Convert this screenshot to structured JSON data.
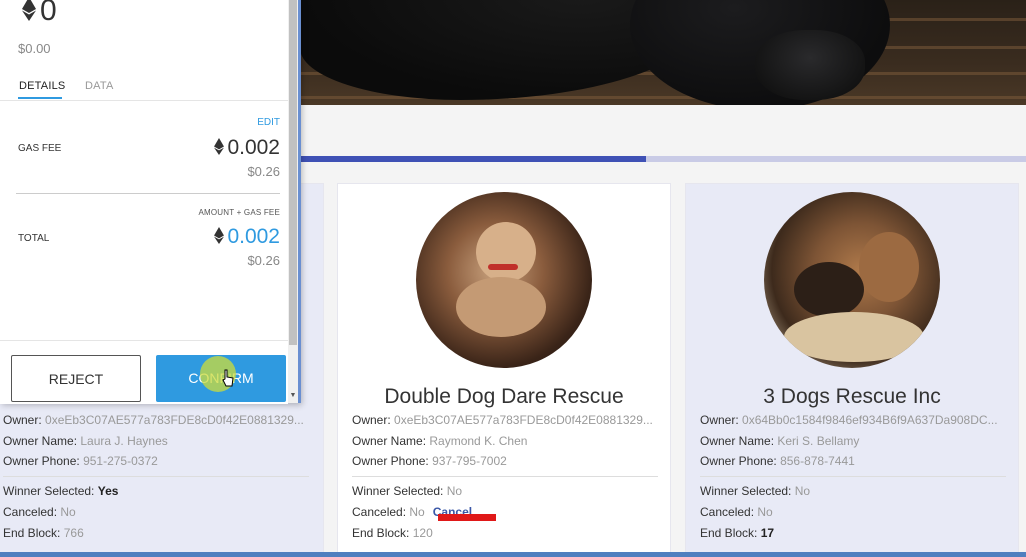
{
  "wallet": {
    "amount": "0",
    "usd": "$0.00",
    "tabs": [
      "DETAILS",
      "DATA"
    ],
    "edit_label": "EDIT",
    "gas_fee_label": "GAS FEE",
    "gas_fee_eth": "0.002",
    "gas_fee_usd": "$0.26",
    "amount_gas_label": "AMOUNT + GAS FEE",
    "total_label": "TOTAL",
    "total_eth": "0.002",
    "total_usd": "$0.26",
    "reject_label": "REJECT",
    "confirm_label": "CONFIRM",
    "accent": "#2f9ae0"
  },
  "progress_fraction": 0.477,
  "cards": {
    "left": {
      "owner_label": "Owner:",
      "owner": "0xeEb3C07AE577a783FDE8cD0f42E0881329...",
      "owner_name_label": "Owner Name:",
      "owner_name": "Laura J. Haynes",
      "owner_phone_label": "Owner Phone:",
      "owner_phone": "951-275-0372",
      "winner_label": "Winner Selected:",
      "winner": "Yes",
      "canceled_label": "Canceled:",
      "canceled": "No",
      "end_block_label": "End Block:",
      "end_block": "766"
    },
    "mid": {
      "title": "Double Dog Dare Rescue",
      "owner_label": "Owner:",
      "owner": "0xeEb3C07AE577a783FDE8cD0f42E0881329...",
      "owner_name_label": "Owner Name:",
      "owner_name": "Raymond K. Chen",
      "owner_phone_label": "Owner Phone:",
      "owner_phone": "937-795-7002",
      "winner_label": "Winner Selected:",
      "winner": "No",
      "canceled_label": "Canceled:",
      "canceled": "No",
      "cancel_link": "Cancel",
      "end_block_label": "End Block:",
      "end_block": "120"
    },
    "right": {
      "title": "3 Dogs Rescue Inc",
      "owner_label": "Owner:",
      "owner": "0x64Bb0c1584f9846ef934B6f9A637Da908DC...",
      "owner_name_label": "Owner Name:",
      "owner_name": "Keri S. Bellamy",
      "owner_phone_label": "Owner Phone:",
      "owner_phone": "856-878-7441",
      "winner_label": "Winner Selected:",
      "winner": "No",
      "canceled_label": "Canceled:",
      "canceled": "No",
      "end_block_label": "End Block:",
      "end_block": "17"
    }
  }
}
